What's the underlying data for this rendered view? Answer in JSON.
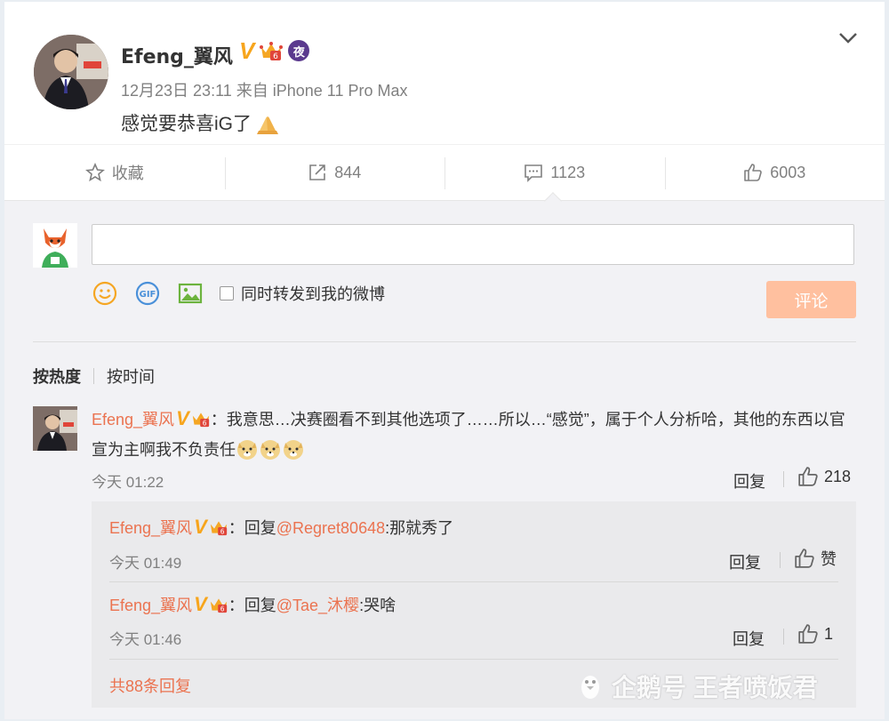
{
  "post": {
    "username": "Efeng_翼风",
    "verified_badge": "V",
    "night_badge": "夜",
    "meta": "12月23日 23:11 来自 iPhone 11 Pro Max",
    "text": "感觉要恭喜iG了",
    "text_emoji": "folded-hands-emoji"
  },
  "actions": {
    "favorite_label": "收藏",
    "repost_count": "844",
    "comment_count": "1123",
    "like_count": "6003"
  },
  "composer": {
    "input_value": "",
    "forward_label": "同时转发到我的微博",
    "submit_label": "评论",
    "tools": [
      "emoji-icon",
      "gif-icon",
      "image-icon"
    ]
  },
  "sort": {
    "hot_label": "按热度",
    "time_label": "按时间"
  },
  "top_comment": {
    "username": "Efeng_翼风",
    "verified_badge": "V",
    "text": "：我意思…决赛圈看不到其他选项了……所以…“感觉”，属于个人分析哈，其他的东西以官宣为主啊我不负责任",
    "time": "今天 01:22",
    "reply_label": "回复",
    "like_count": "218"
  },
  "replies": [
    {
      "username": "Efeng_翼风",
      "verified_badge": "V",
      "prefix": "：回复",
      "mention": "@Regret80648",
      "text": ":那就秀了",
      "time": "今天 01:49",
      "reply_label": "回复",
      "like_label": "赞"
    },
    {
      "username": "Efeng_翼风",
      "verified_badge": "V",
      "prefix": "：回复",
      "mention": "@Tae_沐樱",
      "text": ":哭啥",
      "time": "今天 01:46",
      "reply_label": "回复",
      "like_label": "1"
    }
  ],
  "more_replies": "共88条回复",
  "watermark": "企鹅号 王者喷饭君",
  "colors": {
    "accent": "#eb7350",
    "submit_bg": "#ffc09f",
    "verified": "#f7a51c"
  }
}
